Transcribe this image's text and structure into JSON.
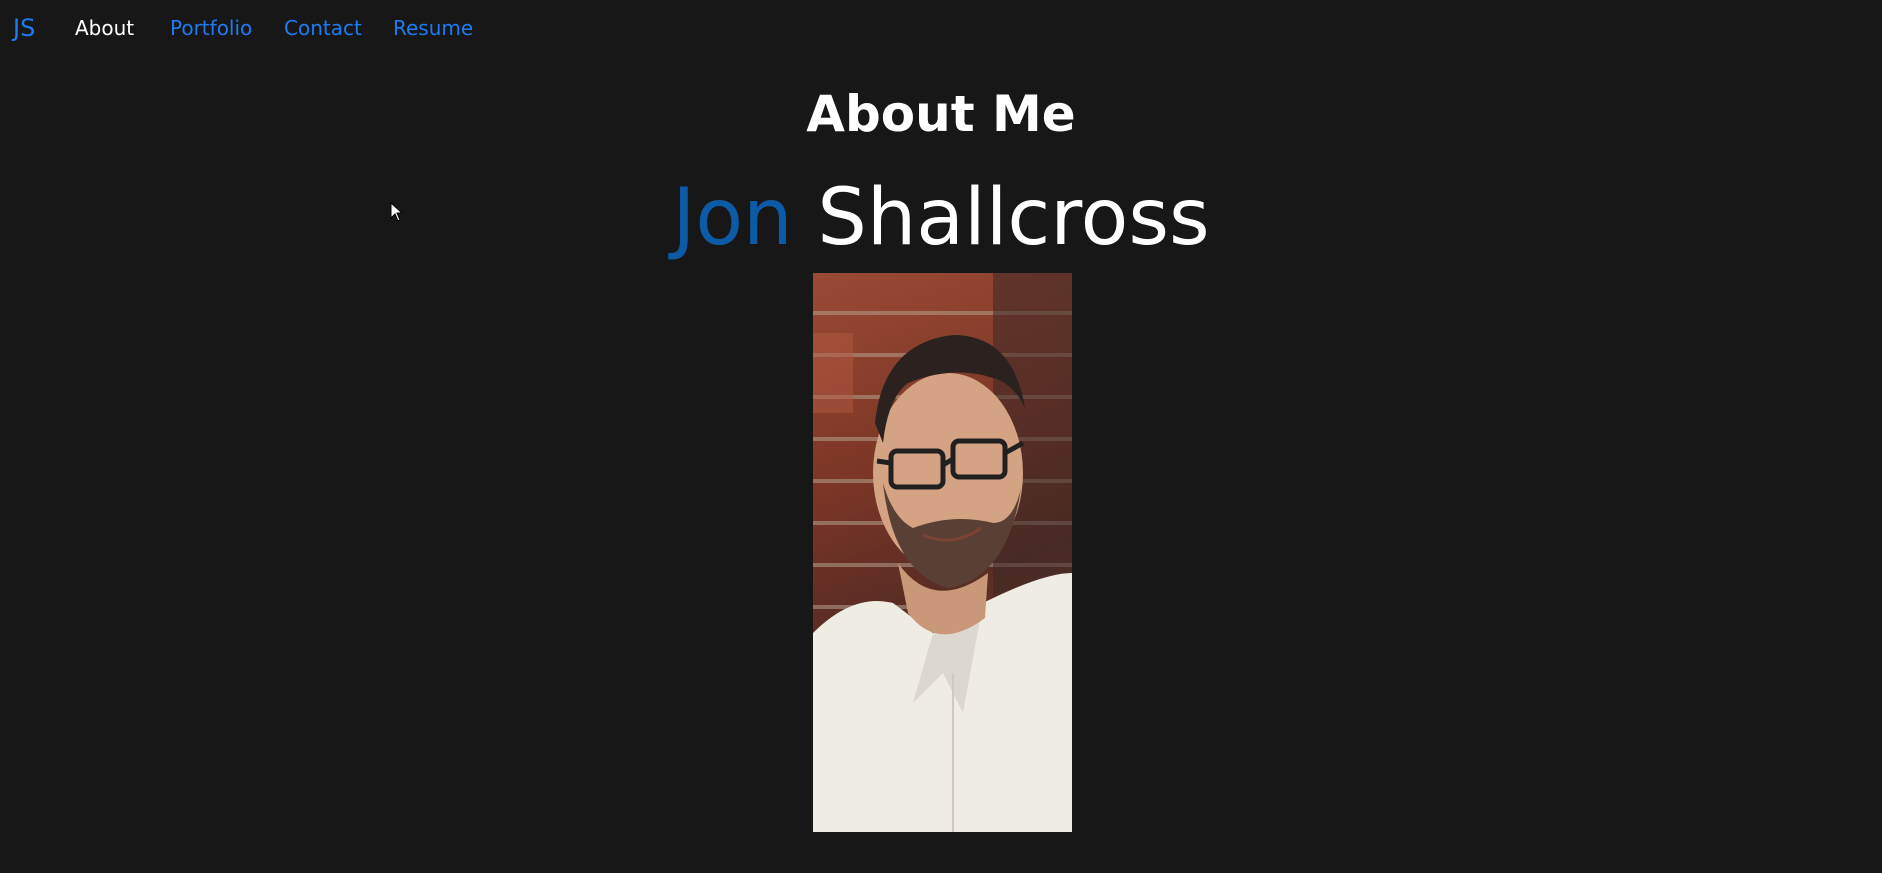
{
  "nav": {
    "brand": "JS",
    "items": [
      {
        "label": "About",
        "active": true
      },
      {
        "label": "Portfolio",
        "active": false
      },
      {
        "label": "Contact",
        "active": false
      },
      {
        "label": "Resume",
        "active": false
      }
    ]
  },
  "main": {
    "title": "About Me",
    "first_name": "Jon",
    "last_name": "Shallcross",
    "photo_alt": "Jon Shallcross portrait"
  },
  "colors": {
    "background": "#171717",
    "link": "#1e7bf2",
    "first_name": "#0d5aa7",
    "text": "#ffffff"
  }
}
